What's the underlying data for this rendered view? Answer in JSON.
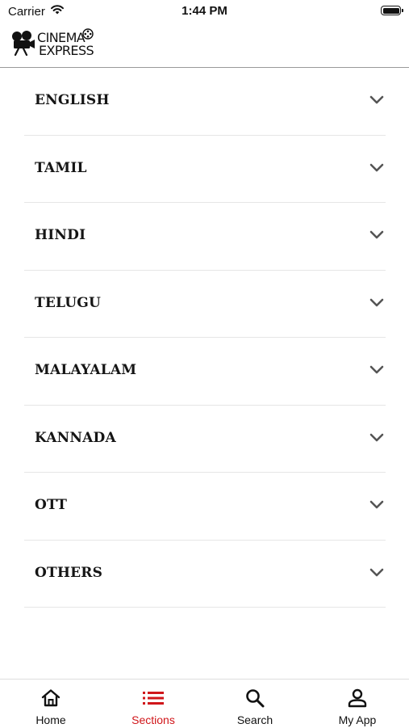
{
  "status_bar": {
    "carrier": "Carrier",
    "time": "1:44 PM"
  },
  "header": {
    "logo_line1": "CINEMA",
    "logo_line2": "EXPRESS"
  },
  "sections": [
    {
      "label": "ENGLISH"
    },
    {
      "label": "TAMIL"
    },
    {
      "label": "HINDI"
    },
    {
      "label": "TELUGU"
    },
    {
      "label": "MALAYALAM"
    },
    {
      "label": "KANNADA"
    },
    {
      "label": "OTT"
    },
    {
      "label": "OTHERS"
    }
  ],
  "tabs": [
    {
      "label": "Home",
      "icon": "home-icon"
    },
    {
      "label": "Sections",
      "icon": "list-icon",
      "active": true
    },
    {
      "label": "Search",
      "icon": "search-icon"
    },
    {
      "label": "My App",
      "icon": "person-icon"
    }
  ],
  "colors": {
    "accent": "#d0161a",
    "text": "#111111",
    "divider": "#e6e6e6"
  }
}
